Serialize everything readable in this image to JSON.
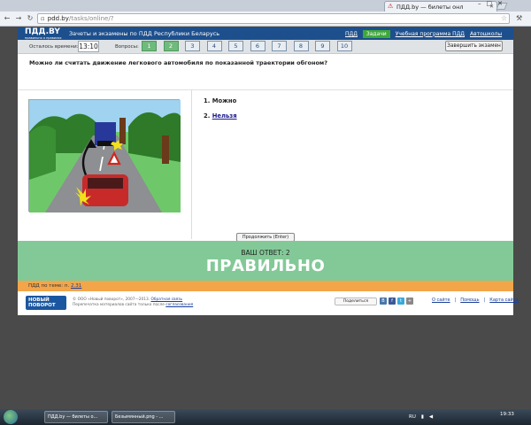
{
  "browser": {
    "tab_title": "ПДД.by — билеты онл",
    "url_host": "pdd.by",
    "url_path": "/tasks/online/?",
    "win_controls": [
      "–",
      "□",
      "✕"
    ]
  },
  "site": {
    "logo": "ПДД.BY",
    "logo_sub": "правильно о правилах",
    "title": "Зачеты и экзамены по ПДД Республики Беларусь",
    "nav": [
      "ПДД",
      "Задачи",
      "Учебная программа ПДД",
      "Автошколы"
    ]
  },
  "exam": {
    "time_label": "Осталось времени:",
    "time_value": "13:10",
    "questions_label": "Вопросы:",
    "questions": [
      "1",
      "2",
      "3",
      "4",
      "5",
      "6",
      "7",
      "8",
      "9",
      "10"
    ],
    "done_questions": [
      1,
      2
    ],
    "finish_label": "Завершить экзамен"
  },
  "question": {
    "text": "Можно ли считать движение легкового автомобиля по показанной траектории обгоном?",
    "answers": [
      {
        "num": "1.",
        "text": "Можно"
      },
      {
        "num": "2.",
        "text": "Нельзя"
      }
    ],
    "continue_label": "Продолжить (Enter)"
  },
  "result": {
    "your_answer_label": "ВАШ ОТВЕТ:",
    "your_answer_value": "2",
    "verdict": "ПРАВИЛЬНО"
  },
  "topic": {
    "label": "ПДД по теме: п.",
    "link": "2.31"
  },
  "footer": {
    "badge_line1": "НОВЫЙ",
    "badge_line2": "ПОВОРОТ",
    "copyright": "© ООО «Новый поворот», 2007—2013.",
    "copyright_link": "Обратная связь",
    "reprint": "Перепечатка материалов сайта только после",
    "reprint_link": "согласования",
    "share": "Поделиться",
    "links": [
      "О сайте",
      "Помощь",
      "Карта сайта"
    ]
  },
  "taskbar": {
    "items": [
      "ПДД.by — билеты о...",
      "Безымянный.png - ..."
    ],
    "lang": "RU",
    "time": "19:33"
  },
  "colors": {
    "site_blue": "#1d4f8d",
    "done_green": "#6fba7c",
    "result_green": "#83c998",
    "topic_orange": "#f3a54a"
  }
}
